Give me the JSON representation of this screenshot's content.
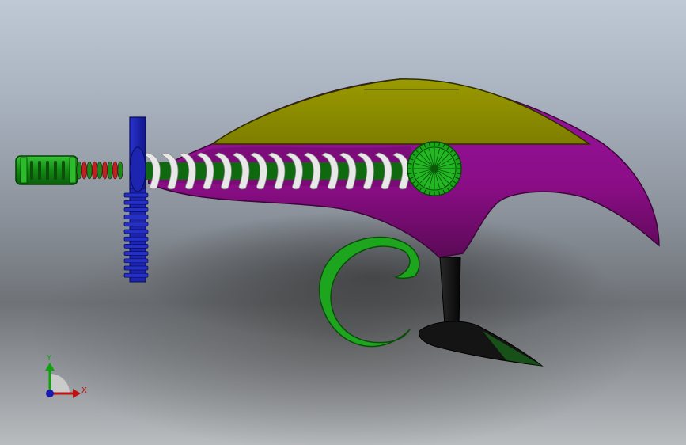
{
  "viewport": {
    "background_top": "#bfc9d6",
    "background_bottom": "#b9bcbf"
  },
  "model": {
    "colors": {
      "body_purple": "#8e0f86",
      "body_purple_dark": "#5b0a56",
      "top_olive": "#8a8a00",
      "spring_white": "#e6e6e6",
      "rod_green": "#1aa31a",
      "handle_blue": "#1c24b0",
      "trigger_green": "#1ea51e",
      "grip_black": "#111111",
      "gear_green": "#1db11d",
      "nozzle_green": "#1d9b1d",
      "nozzle_red": "#c02020"
    }
  },
  "triad": {
    "x_label": "X",
    "y_label": "Y",
    "x_color": "#c01010",
    "y_color": "#10a010",
    "z_color": "#1a1ab0"
  }
}
